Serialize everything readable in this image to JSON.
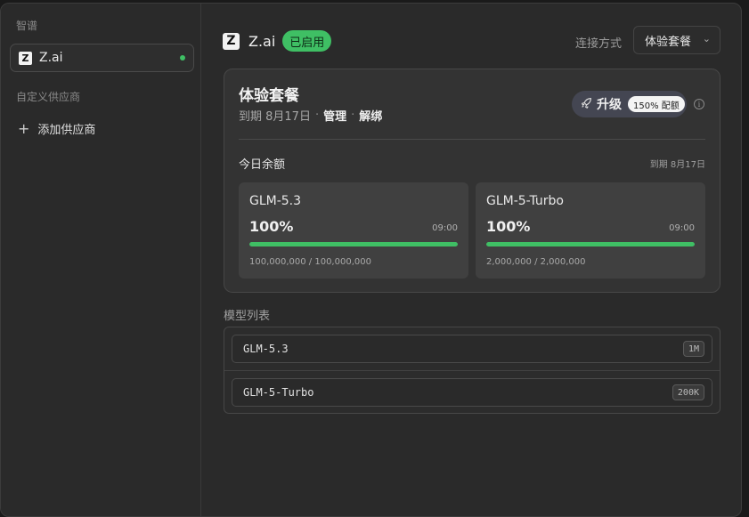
{
  "sidebar": {
    "section_builtin": "智谱",
    "provider": {
      "logo_letter": "Z",
      "name": "Z.ai",
      "status_color": "#3fbf64"
    },
    "section_custom": "自定义供应商",
    "add_provider_label": "添加供应商",
    "add_icon": "plus-icon"
  },
  "header": {
    "logo_letter": "Z",
    "title": "Z.ai",
    "status_badge": "已启用",
    "connection_label": "连接方式",
    "connection_value": "体验套餐"
  },
  "plan": {
    "title": "体验套餐",
    "expiry_text": "到期 8月17日",
    "manage_link": "管理",
    "unbind_link": "解绑",
    "upgrade_label": "升级",
    "upgrade_bonus": "150% 配额",
    "upgrade_icon": "rocket-icon",
    "info_icon": "info-icon",
    "balance_label": "今日余额",
    "balance_expiry": "到期 8月17日",
    "quotas": [
      {
        "model": "GLM-5.3",
        "percent": "100%",
        "percent_value": 100,
        "reset_time": "09:00",
        "usage": "100,000,000 / 100,000,000"
      },
      {
        "model": "GLM-5-Turbo",
        "percent": "100%",
        "percent_value": 100,
        "reset_time": "09:00",
        "usage": "2,000,000 / 2,000,000"
      }
    ]
  },
  "models": {
    "section_label": "模型列表",
    "items": [
      {
        "name": "GLM-5.3",
        "context": "1M"
      },
      {
        "name": "GLM-5-Turbo",
        "context": "200K"
      }
    ]
  },
  "colors": {
    "accent_green": "#3fbf64",
    "background": "#2a2a2a",
    "card": "#333333"
  }
}
